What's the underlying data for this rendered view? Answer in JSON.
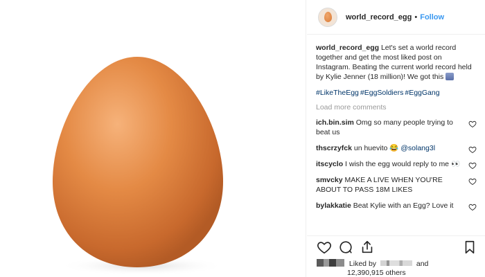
{
  "post": {
    "username": "world_record_egg",
    "separator": "•",
    "follow_label": "Follow"
  },
  "caption": {
    "user": "world_record_egg",
    "text": "Let's set a world record together and get the most liked post on Instagram. Beating the current world record held by Kylie Jenner (18 million)! We got this"
  },
  "hashtags": [
    "#LikeTheEgg",
    "#EggSoldiers",
    "#EggGang"
  ],
  "load_more": "Load more comments",
  "comments": [
    {
      "user": "ich.bin.sim",
      "text": "Omg so many people trying to beat us"
    },
    {
      "user": "thscrzyfck",
      "text": "un huevito 😂",
      "mention": "@solang3l"
    },
    {
      "user": "itscyclo",
      "text": "I wish the egg would reply to me 👀"
    },
    {
      "user": "smvcky",
      "text": "MAKE A LIVE WHEN YOU'RE ABOUT TO PASS 18M LIKES"
    },
    {
      "user": "bylakkatie",
      "text": "Beat Kylie with an Egg? Love it"
    }
  ],
  "likes": {
    "prefix": "Liked by",
    "suffix": "and",
    "count": "12,390,915 others"
  },
  "icons": [
    "egg-photo",
    "heart-icon",
    "comment-icon",
    "share-icon",
    "bookmark-icon"
  ],
  "colors": {
    "link": "#3897f0",
    "hashtag": "#003569",
    "muted": "#999999",
    "egg": "#e08a4a"
  }
}
